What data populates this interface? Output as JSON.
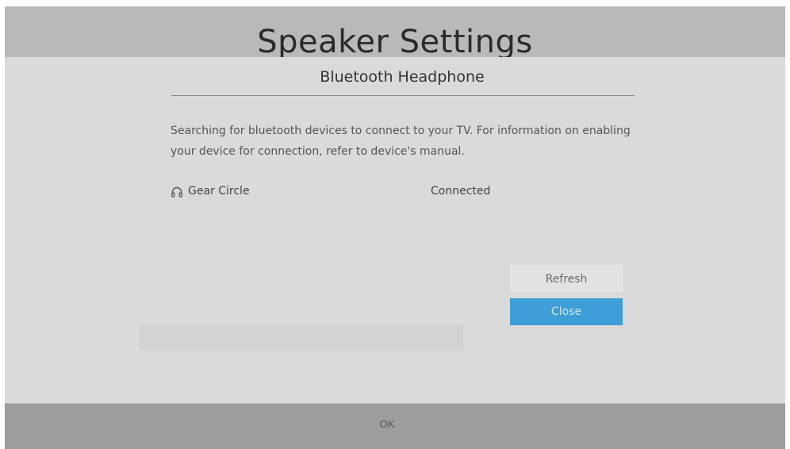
{
  "background": {
    "title": "Speaker Settings",
    "footer_button": "OK"
  },
  "dialog": {
    "title": "Bluetooth Headphone",
    "description": "Searching for bluetooth devices to connect to your TV. For information on enabling your device for connection, refer to device's manual.",
    "devices": [
      {
        "icon": "headphone-icon",
        "name": "Gear Circle",
        "status": "Connected"
      }
    ],
    "buttons": {
      "refresh": "Refresh",
      "close": "Close"
    }
  },
  "colors": {
    "accent": "#3d9ed8",
    "dialog_bg": "#dadada",
    "screen_bg": "#b9b9b9"
  }
}
